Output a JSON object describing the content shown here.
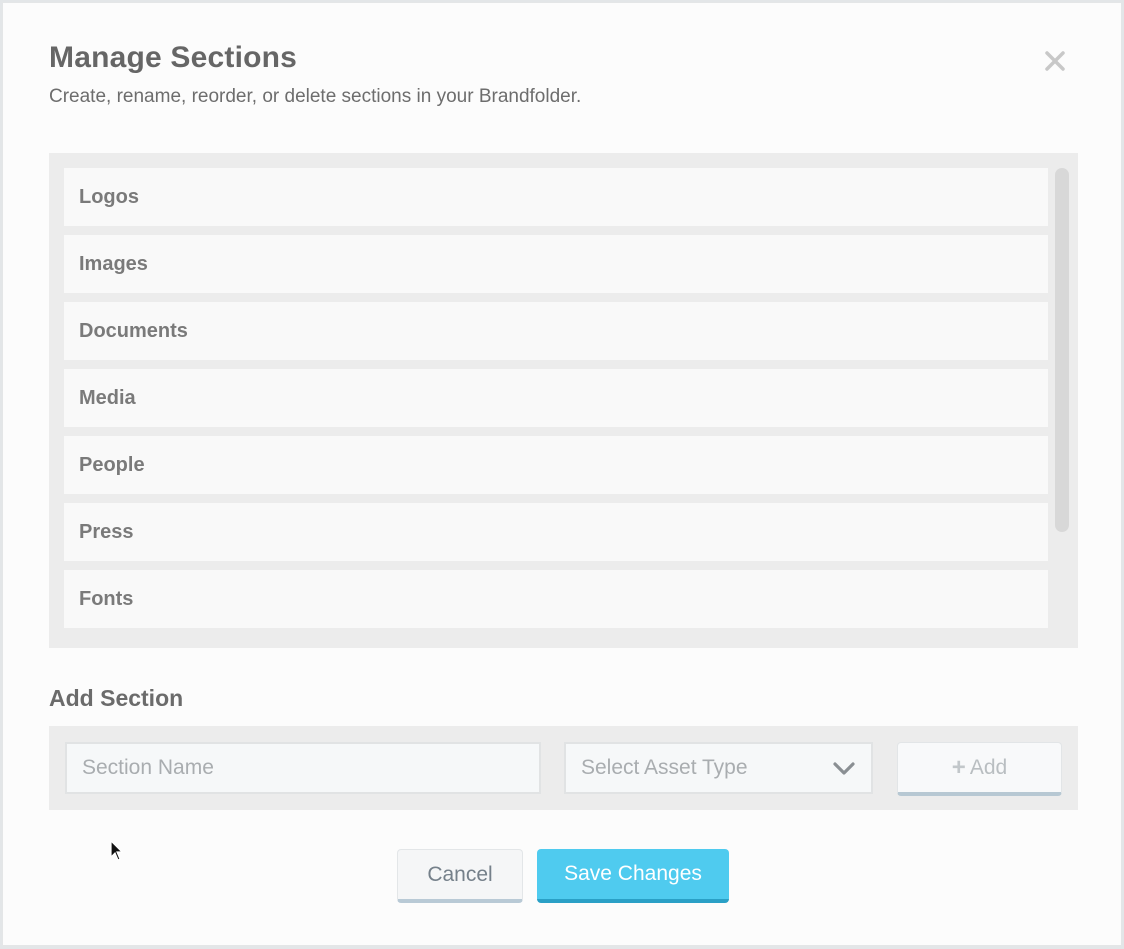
{
  "modal": {
    "title": "Manage Sections",
    "subtitle": "Create, rename, reorder, or delete sections in your Brandfolder.",
    "close_icon": "close-icon"
  },
  "sections": [
    {
      "label": "Logos"
    },
    {
      "label": "Images"
    },
    {
      "label": "Documents"
    },
    {
      "label": "Media"
    },
    {
      "label": "People"
    },
    {
      "label": "Press"
    },
    {
      "label": "Fonts"
    }
  ],
  "add_section": {
    "heading": "Add Section",
    "name_placeholder": "Section Name",
    "asset_type_placeholder": "Select Asset Type",
    "add_label": "Add",
    "add_icon": "plus-icon"
  },
  "footer": {
    "cancel_label": "Cancel",
    "save_label": "Save Changes"
  },
  "colors": {
    "accent": "#4fcbef",
    "accent_dark": "#2aa0c6",
    "list_bg": "#ececec",
    "item_bg": "#f9f9f9"
  }
}
